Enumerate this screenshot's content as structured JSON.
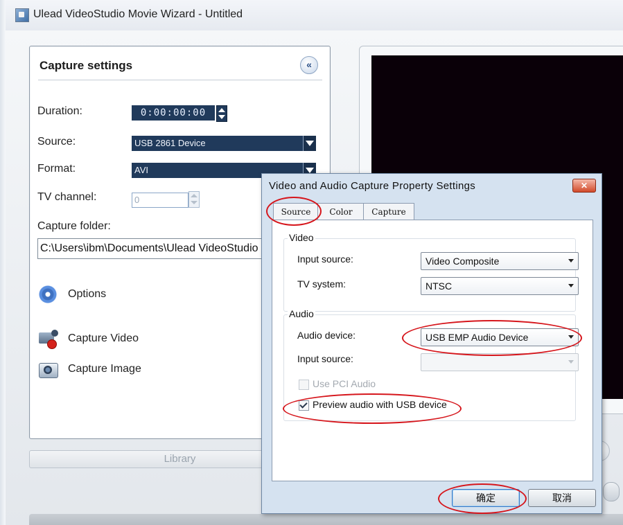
{
  "window": {
    "title": "Ulead VideoStudio Movie Wizard - Untitled"
  },
  "panel": {
    "title": "Capture settings",
    "collapse_glyph": "«",
    "duration": {
      "label": "Duration:",
      "value": "0:00:00:00"
    },
    "source": {
      "label": "Source:",
      "value": "USB 2861 Device"
    },
    "format": {
      "label": "Format:",
      "value": "AVI"
    },
    "tv_channel": {
      "label": "TV channel:",
      "value": "0"
    },
    "capture_folder": {
      "label": "Capture folder:",
      "value": "C:\\Users\\ibm\\Documents\\Ulead VideoStudio"
    },
    "options_label": "Options",
    "capture_video_label": "Capture Video",
    "capture_image_label": "Capture Image",
    "library_label": "Library"
  },
  "dialog": {
    "title": "Video and Audio Capture Property Settings",
    "close_glyph": "✕",
    "tabs": [
      {
        "label": "Source",
        "active": true
      },
      {
        "label": "Color",
        "active": false
      },
      {
        "label": "Capture",
        "active": false
      }
    ],
    "video_group": {
      "label": "Video",
      "input_source": {
        "label": "Input source:",
        "value": "Video Composite"
      },
      "tv_system": {
        "label": "TV system:",
        "value": "NTSC"
      }
    },
    "audio_group": {
      "label": "Audio",
      "audio_device": {
        "label": "Audio device:",
        "value": "USB EMP Audio Device"
      },
      "input_source": {
        "label": "Input source:",
        "value": ""
      },
      "use_pci_audio": {
        "label": "Use PCI Audio",
        "checked": false,
        "enabled": false
      },
      "preview_audio": {
        "label": "Preview audio with USB device",
        "checked": true,
        "enabled": true
      }
    },
    "ok_label": "确定",
    "cancel_label": "取消"
  },
  "colors": {
    "dark_field": "#203a5b",
    "annotation_red": "#d6161c",
    "preview_screen": "#0a0008"
  }
}
